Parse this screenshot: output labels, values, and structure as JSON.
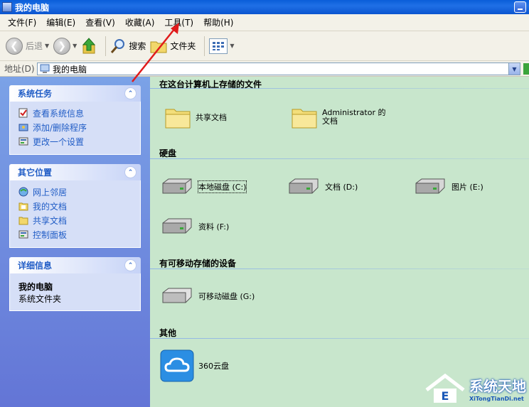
{
  "window": {
    "title": "我的电脑"
  },
  "menubar": {
    "items": [
      "文件(F)",
      "编辑(E)",
      "查看(V)",
      "收藏(A)",
      "工具(T)",
      "帮助(H)"
    ]
  },
  "toolbar": {
    "back_label": "后退",
    "search_label": "搜索",
    "folders_label": "文件夹"
  },
  "addressbar": {
    "label": "地址(D)",
    "value": "我的电脑"
  },
  "sidebar": {
    "panels": [
      {
        "title": "系统任务",
        "items": [
          "查看系统信息",
          "添加/删除程序",
          "更改一个设置"
        ]
      },
      {
        "title": "其它位置",
        "items": [
          "网上邻居",
          "我的文档",
          "共享文档",
          "控制面板"
        ]
      },
      {
        "title": "详细信息",
        "detail_title": "我的电脑",
        "detail_sub": "系统文件夹"
      }
    ]
  },
  "content": {
    "groups": [
      {
        "title": "在这台计算机上存储的文件"
      },
      {
        "title": "硬盘"
      },
      {
        "title": "有可移动存储的设备"
      },
      {
        "title": "其他"
      }
    ],
    "stored_files": [
      "共享文档",
      "Administrator 的文档"
    ],
    "hard_drives": [
      "本地磁盘 (C:)",
      "文档 (D:)",
      "图片 (E:)",
      "资料 (F:)"
    ],
    "removable": [
      "可移动磁盘 (G:)"
    ],
    "other": [
      "360云盘"
    ]
  },
  "watermark": {
    "main": "系统天地",
    "sub": "XiTongTianDi.net"
  },
  "colors": {
    "titlebar": "#0b55cf",
    "sidebar": "#7ba2e7",
    "content_bg": "#c8e6cc",
    "link": "#215dc6",
    "annotation_arrow": "#e01b1b"
  }
}
